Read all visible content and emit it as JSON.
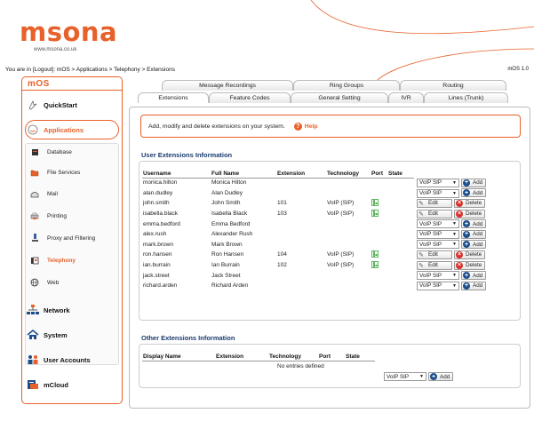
{
  "header": {
    "logo_text": "msona",
    "logo_url": "www.msona.co.uk",
    "breadcrumb": "You are in [Logout]: mOS > Applications > Telephony > Extensions",
    "version": "mOS 1.0"
  },
  "sidebar": {
    "title": "mOS",
    "items": [
      {
        "label": "QuickStart"
      },
      {
        "label": "Applications"
      },
      {
        "label": "Database"
      },
      {
        "label": "File Services"
      },
      {
        "label": "Mail"
      },
      {
        "label": "Printing"
      },
      {
        "label": "Proxy and Filtering"
      },
      {
        "label": "Telephony"
      },
      {
        "label": "Web"
      },
      {
        "label": "Network"
      },
      {
        "label": "System"
      },
      {
        "label": "User Accounts"
      },
      {
        "label": "mCloud"
      }
    ]
  },
  "tabs": {
    "row1": [
      "Message Recordings",
      "Ring Groups",
      "Routing"
    ],
    "row2": [
      "Extensions",
      "Feature Codes",
      "General Setting",
      "IVR",
      "Lines (Trunk)"
    ]
  },
  "info": {
    "text": "Add, modify and delete extensions on your system.",
    "help": "Help"
  },
  "user_ext": {
    "title": "User Extensions Information",
    "headers": [
      "Username",
      "Full Name",
      "Extension",
      "Technology",
      "Port",
      "State"
    ],
    "rows": [
      {
        "username": "monica.hilton",
        "fullname": "Monica Hilton",
        "extension": "",
        "technology": "",
        "port": false,
        "mode": "add"
      },
      {
        "username": "alan.dudley",
        "fullname": "Alan Dudley",
        "extension": "",
        "technology": "",
        "port": false,
        "mode": "add"
      },
      {
        "username": "john.smith",
        "fullname": "John Smith",
        "extension": "101",
        "technology": "VoIP (SIP)",
        "port": true,
        "mode": "edit"
      },
      {
        "username": "isabella.black",
        "fullname": "Isabella Black",
        "extension": "103",
        "technology": "VoIP (SIP)",
        "port": true,
        "mode": "edit"
      },
      {
        "username": "emma.bedford",
        "fullname": "Emma Bedford",
        "extension": "",
        "technology": "",
        "port": false,
        "mode": "add"
      },
      {
        "username": "alex.rush",
        "fullname": "Alexander Rush",
        "extension": "",
        "technology": "",
        "port": false,
        "mode": "add"
      },
      {
        "username": "mark.brown",
        "fullname": "Mark Brown",
        "extension": "",
        "technology": "",
        "port": false,
        "mode": "add"
      },
      {
        "username": "ron.hansen",
        "fullname": "Ron Hansen",
        "extension": "104",
        "technology": "VoIP (SIP)",
        "port": true,
        "mode": "edit"
      },
      {
        "username": "ian.burrain",
        "fullname": "Ian Burrain",
        "extension": "102",
        "technology": "VoIP (SIP)",
        "port": true,
        "mode": "edit"
      },
      {
        "username": "jack.street",
        "fullname": "Jack Street",
        "extension": "",
        "technology": "",
        "port": false,
        "mode": "add"
      },
      {
        "username": "richard.arden",
        "fullname": "Richard Arden",
        "extension": "",
        "technology": "",
        "port": false,
        "mode": "add"
      }
    ],
    "select_value": "VoIP SIP",
    "add_label": "Add",
    "edit_label": "Edit",
    "delete_label": "Delete"
  },
  "other_ext": {
    "title": "Other Extensions Information",
    "headers": [
      "Display Name",
      "Extension",
      "Technology",
      "Port",
      "State"
    ],
    "empty_text": "No entries defined",
    "select_value": "VoIP SIP",
    "add_label": "Add"
  },
  "colors": {
    "accent": "#e8602a",
    "section_title": "#1a3b6e",
    "add_icon": "#1c4e8a",
    "delete_icon": "#d9312b",
    "port_icon": "#3aa53a"
  }
}
